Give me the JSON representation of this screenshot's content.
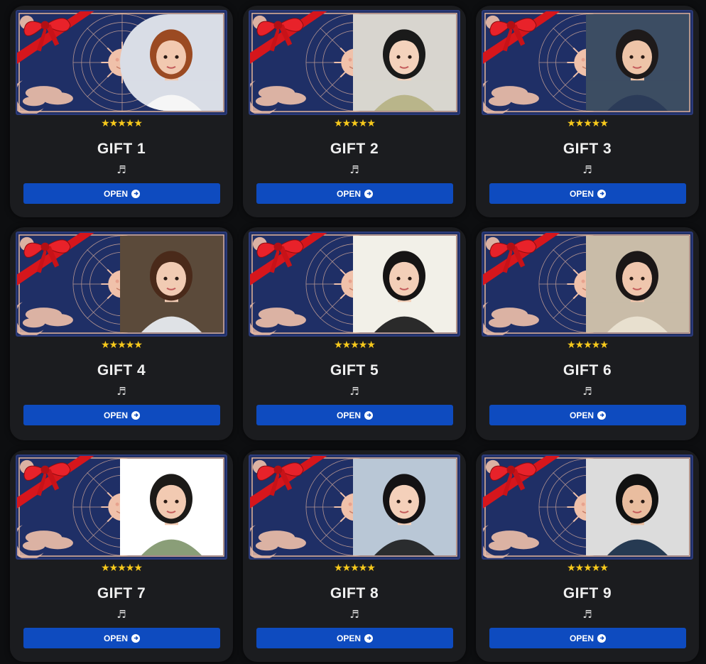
{
  "gifts": [
    {
      "title": "GIFT 1",
      "rating": "★★★★★",
      "note_icon": "♬",
      "button_label": "OPEN",
      "photo_shape": "round"
    },
    {
      "title": "GIFT 2",
      "rating": "★★★★★",
      "note_icon": "♬",
      "button_label": "OPEN",
      "photo_shape": "rect"
    },
    {
      "title": "GIFT 3",
      "rating": "★★★★★",
      "note_icon": "♬",
      "button_label": "OPEN",
      "photo_shape": "rect"
    },
    {
      "title": "GIFT 4",
      "rating": "★★★★★",
      "note_icon": "♬",
      "button_label": "OPEN",
      "photo_shape": "rect"
    },
    {
      "title": "GIFT 5",
      "rating": "★★★★★",
      "note_icon": "♬",
      "button_label": "OPEN",
      "photo_shape": "rect"
    },
    {
      "title": "GIFT 6",
      "rating": "★★★★★",
      "note_icon": "♬",
      "button_label": "OPEN",
      "photo_shape": "rect"
    },
    {
      "title": "GIFT 7",
      "rating": "★★★★★",
      "note_icon": "♬",
      "button_label": "OPEN",
      "photo_shape": "rect"
    },
    {
      "title": "GIFT 8",
      "rating": "★★★★★",
      "note_icon": "♬",
      "button_label": "OPEN",
      "photo_shape": "rect"
    },
    {
      "title": "GIFT 9",
      "rating": "★★★★★",
      "note_icon": "♬",
      "button_label": "OPEN",
      "photo_shape": "rect"
    }
  ],
  "rating_value": 5,
  "rating_max": 5,
  "colors": {
    "page_bg": "#0d0e10",
    "card_bg": "#1b1c1f",
    "banner_blue": "#1f2f66",
    "ribbon_red": "#d6161c",
    "star_gold": "#f7c91c",
    "button_blue": "#0e4bbf"
  },
  "icons": {
    "ribbon": "red-bow-icon",
    "sun": "zodiac-sun-icon",
    "note": "music-note-icon",
    "arrow": "arrow-right-circle-icon"
  }
}
